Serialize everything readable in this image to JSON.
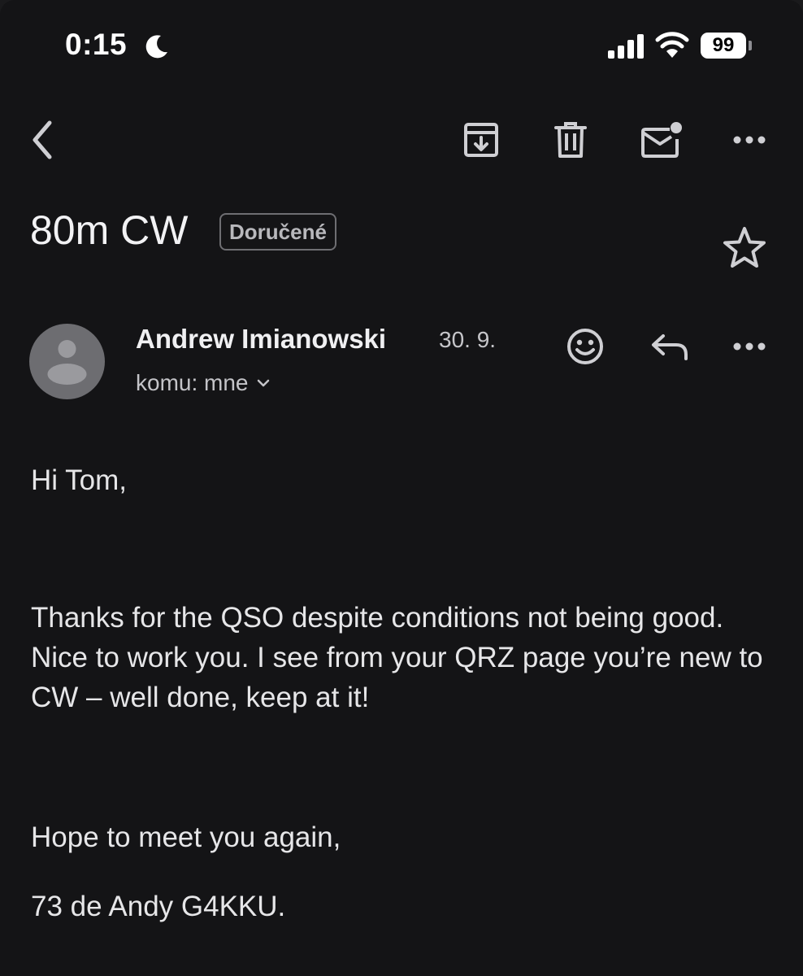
{
  "status_bar": {
    "time": "0:15",
    "battery_level": "99",
    "icons": [
      "moon-icon",
      "signal-icon",
      "wifi-icon",
      "battery-icon"
    ]
  },
  "toolbar": {
    "icons": [
      "back-chevron-icon",
      "archive-icon",
      "trash-icon",
      "mark-unread-icon",
      "more-horizontal-icon"
    ]
  },
  "email": {
    "subject": "80m CW",
    "label": "Doručené",
    "starred": false,
    "sender": {
      "name": "Andrew Imianowski",
      "date": "30. 9.",
      "recipient": "komu: mne"
    },
    "body": {
      "greeting": "Hi Tom,",
      "paragraph": "Thanks for the QSO despite conditions not being good. Nice to work you. I see from your QRZ page you’re new to CW – well done, keep at it!",
      "closing": "Hope to meet you again,",
      "signature": "73 de Andy G4KKU."
    }
  },
  "colors": {
    "background": "#141416",
    "text_primary": "#e6e6e8",
    "text_secondary": "#c4c4c8",
    "icon": "#cfcfd3",
    "avatar": "#6d6d71"
  }
}
